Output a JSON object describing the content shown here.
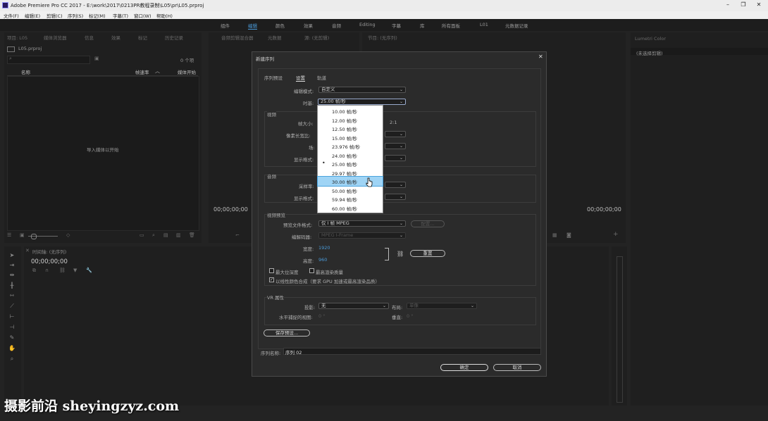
{
  "window": {
    "title": "Adobe Premiere Pro CC 2017 - E:\\work\\2017\\0213PR教程录制\\L05\\pr\\L05.prproj",
    "min": "–",
    "max": "❐",
    "close": "✕"
  },
  "menu": [
    "文件(F)",
    "编辑(E)",
    "剪辑(C)",
    "序列(S)",
    "标记(M)",
    "字幕(T)",
    "窗口(W)",
    "帮助(H)"
  ],
  "workspaces": {
    "items": [
      "组件",
      "编辑",
      "颜色",
      "效果",
      "音频",
      "Editing",
      "字幕",
      "库",
      "所有面板",
      "L01",
      "元数据记录"
    ],
    "active": "编辑"
  },
  "project_panel": {
    "tabs": [
      "项目: L05",
      "媒体浏览器",
      "信息",
      "效果",
      "标记",
      "历史记录"
    ],
    "file": "L05.prproj",
    "count": "0 个项",
    "col_name": "名称",
    "col_rate": "帧速率",
    "col_start": "媒体开始",
    "empty_hint": "导入媒体以开始"
  },
  "source_panel": {
    "tabs": [
      "音频剪辑混合器",
      "元数据",
      "源: (无剪辑)"
    ],
    "timecode": "00;00;00;00"
  },
  "program_panel": {
    "tab": "节目: (无序列)",
    "timecode": "00;00;00;00"
  },
  "lumetri": {
    "tab": "Lumetri Color",
    "hint": "(未选择剪辑)"
  },
  "timeline": {
    "tab": "时间轴: (无序列)",
    "timecode": "00;00;00;00"
  },
  "dialog": {
    "title": "新建序列",
    "close": "✕",
    "tabs": [
      "序列预设",
      "设置",
      "轨道"
    ],
    "active_tab": "设置",
    "edit_mode_label": "编辑模式:",
    "edit_mode_value": "自定义",
    "timebase_label": "时基:",
    "timebase_value": "25.00 帧/秒",
    "video_section": "视频",
    "frame_size_label": "帧大小:",
    "frame_ratio": "2:1",
    "pixel_aspect_label": "像素长宽比:",
    "field_label": "场:",
    "display_format_label": "显示格式:",
    "audio_section": "音频",
    "sample_rate_label": "采样率:",
    "audio_display_label": "显示格式:",
    "preview_section": "视频预览",
    "preview_format_label": "预览文件格式:",
    "preview_format_value": "仅 I 帧 MPEG",
    "configure_button": "配置...",
    "codec_label": "编解码器:",
    "codec_value": "MPEG I-Frame",
    "width_label": "宽度:",
    "width_value": "1920",
    "height_label": "高度:",
    "height_value": "960",
    "reset_button": "重置",
    "max_depth_label": "最大位深度",
    "max_quality_label": "最高渲染质量",
    "linear_color_label": "以线性颜色合成（要求 GPU 加速或最高渲染品质）",
    "linear_color_checked": true,
    "vr_section": "VR 属性",
    "projection_label": "投影:",
    "projection_value": "无",
    "layout_label": "布局:",
    "layout_value": "单像",
    "horizontal_label": "水平捕捉的视图:",
    "horizontal_value": "0 °",
    "vertical_label": "垂直:",
    "vertical_value": "0 °",
    "save_preset_button": "保存预设...",
    "sequence_name_label": "序列名称:",
    "sequence_name_value": "序列 02",
    "ok_button": "确定",
    "cancel_button": "取消"
  },
  "timebase_options": [
    {
      "value": "10.00  帧/秒",
      "selected": false,
      "hover": false
    },
    {
      "value": "12.00  帧/秒",
      "selected": false,
      "hover": false
    },
    {
      "value": "12.50  帧/秒",
      "selected": false,
      "hover": false
    },
    {
      "value": "15.00  帧/秒",
      "selected": false,
      "hover": false
    },
    {
      "value": "23.976  帧/秒",
      "selected": false,
      "hover": false
    },
    {
      "value": "24.00  帧/秒",
      "selected": false,
      "hover": false
    },
    {
      "value": "25.00  帧/秒",
      "selected": true,
      "hover": false
    },
    {
      "value": "29.97  帧/秒",
      "selected": false,
      "hover": false
    },
    {
      "value": "30.00  帧/秒",
      "selected": false,
      "hover": true
    },
    {
      "value": "50.00  帧/秒",
      "selected": false,
      "hover": false
    },
    {
      "value": "59.94  帧/秒",
      "selected": false,
      "hover": false
    },
    {
      "value": "60.00  帧/秒",
      "selected": false,
      "hover": false
    }
  ],
  "watermark": "摄影前沿 sheyingzyz.com",
  "colors": {
    "accent": "#4a9ad8",
    "hover": "#9fd4f5",
    "panel": "#1f1f1f"
  }
}
